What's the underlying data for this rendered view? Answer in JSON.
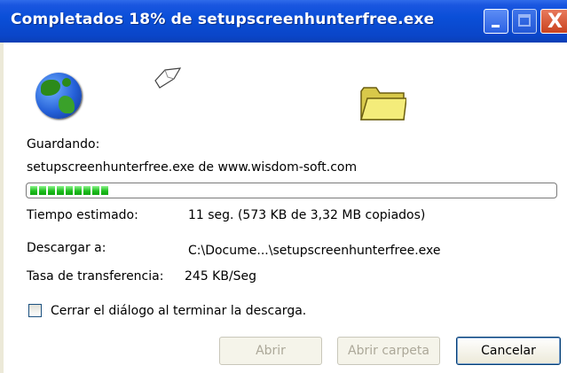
{
  "window": {
    "title": "Completados 18% de setupscreenhunterfree.exe",
    "controls": {
      "minimize": "minimize",
      "maximize": "maximize",
      "close": "X"
    }
  },
  "icons": {
    "source": "globe-icon",
    "transfer": "flying-paper-icon",
    "destination": "folder-icon"
  },
  "status": {
    "saving_label": "Guardando:",
    "file_source": "setupscreenhunterfree.exe de www.wisdom-soft.com"
  },
  "progress": {
    "percent": 18,
    "segments": 9,
    "color": "#1fbf1f"
  },
  "details": {
    "time_label": "Tiempo estimado:",
    "time_value": "11 seg. (573 KB de 3,32 MB copiados)",
    "download_to_label": "Descargar a:",
    "download_to_value": "C:\\Docume...\\setupscreenhunterfree.exe",
    "rate_label": "Tasa de transferencia:",
    "rate_value": "245 KB/Seg"
  },
  "options": {
    "close_on_finish_label": "Cerrar el diálogo al terminar la descarga.",
    "close_on_finish_checked": false
  },
  "buttons": {
    "open": "Abrir",
    "open_folder": "Abrir carpeta",
    "cancel": "Cancelar"
  },
  "colors": {
    "titlebar": "#0a4fd8",
    "progress": "#1fbf1f",
    "cancel_border": "#003c74"
  }
}
